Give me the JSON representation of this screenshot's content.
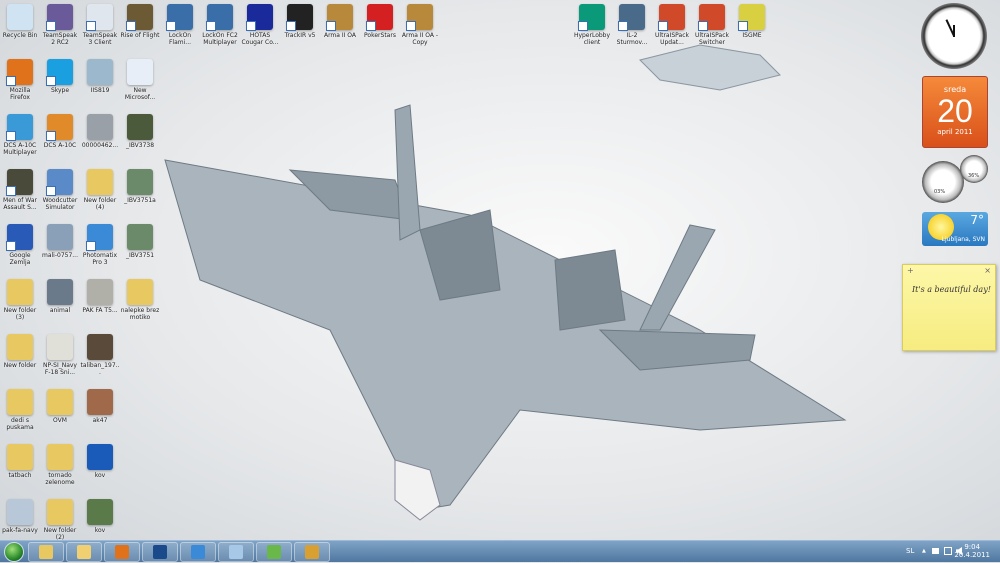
{
  "desktop_icons": [
    {
      "label": "Recycle Bin",
      "color": "#cfe3f2",
      "col": 0,
      "row": 0,
      "shortcut": false
    },
    {
      "label": "TeamSpeak 2 RC2",
      "color": "#6a5a9a",
      "col": 1,
      "row": 0
    },
    {
      "label": "TeamSpeak 3 Client",
      "color": "#dfe6ee",
      "col": 2,
      "row": 0
    },
    {
      "label": "Rise of Flight",
      "color": "#6b5a33",
      "col": 3,
      "row": 0
    },
    {
      "label": "LockOn Flami...",
      "color": "#3a6ea8",
      "col": 4,
      "row": 0
    },
    {
      "label": "LockOn FC2 Multiplayer",
      "color": "#3a6ea8",
      "col": 5,
      "row": 0
    },
    {
      "label": "HOTAS Cougar Co...",
      "color": "#1a2a9a",
      "col": 6,
      "row": 0
    },
    {
      "label": "TrackIR v5",
      "color": "#222222",
      "col": 7,
      "row": 0
    },
    {
      "label": "Arma II OA",
      "color": "#b8893a",
      "col": 8,
      "row": 0
    },
    {
      "label": "PokerStars",
      "color": "#d42020",
      "col": 9,
      "row": 0
    },
    {
      "label": "Arma II OA - Copy",
      "color": "#b8893a",
      "col": 10,
      "row": 0
    },
    {
      "label": "HyperLobby client",
      "color": "#0a9a7a",
      "col": 14.3,
      "row": 0
    },
    {
      "label": "IL-2 Sturmov...",
      "color": "#4a6a8a",
      "col": 15.3,
      "row": 0
    },
    {
      "label": "UltraISPack Updat...",
      "color": "#d04a2a",
      "col": 16.3,
      "row": 0
    },
    {
      "label": "UltraISPack Switcher",
      "color": "#d04a2a",
      "col": 17.3,
      "row": 0
    },
    {
      "label": "ISGME",
      "color": "#d8d040",
      "col": 18.3,
      "row": 0
    },
    {
      "label": "Mozilla Firefox",
      "color": "#e0721c",
      "col": 0,
      "row": 1
    },
    {
      "label": "Skype",
      "color": "#1aa0e0",
      "col": 1,
      "row": 1
    },
    {
      "label": "IIS819",
      "color": "#9bb8cc",
      "col": 2,
      "row": 1,
      "shortcut": false
    },
    {
      "label": "New Microsof...",
      "color": "#e8eef8",
      "col": 3,
      "row": 1,
      "shortcut": false
    },
    {
      "label": "DCS A-10C Multiplayer",
      "color": "#3a9ad8",
      "col": 0,
      "row": 2
    },
    {
      "label": "DCS A-10C",
      "color": "#e08a2a",
      "col": 1,
      "row": 2
    },
    {
      "label": "00000462...",
      "color": "#9aa0a8",
      "col": 2,
      "row": 2,
      "shortcut": false
    },
    {
      "label": "_IBV3738",
      "color": "#4a5a3a",
      "col": 3,
      "row": 2,
      "shortcut": false
    },
    {
      "label": "Men of War Assault S...",
      "color": "#4a4a3a",
      "col": 0,
      "row": 3
    },
    {
      "label": "Woodcutter Simulator",
      "color": "#5a8ac8",
      "col": 1,
      "row": 3
    },
    {
      "label": "New folder (4)",
      "color": "#e8c860",
      "col": 2,
      "row": 3,
      "shortcut": false
    },
    {
      "label": "_IBV3751a",
      "color": "#6a8a6a",
      "col": 3,
      "row": 3,
      "shortcut": false
    },
    {
      "label": "Google Zemlja",
      "color": "#2a5ab8",
      "col": 0,
      "row": 4
    },
    {
      "label": "mali-0757...",
      "color": "#8aa0b8",
      "col": 1,
      "row": 4,
      "shortcut": false
    },
    {
      "label": "Photomatix Pro 3",
      "color": "#3a8ad8",
      "col": 2,
      "row": 4
    },
    {
      "label": "_IBV3751",
      "color": "#6a8a6a",
      "col": 3,
      "row": 4,
      "shortcut": false
    },
    {
      "label": "New folder (3)",
      "color": "#e8c860",
      "col": 0,
      "row": 5,
      "shortcut": false
    },
    {
      "label": "animal",
      "color": "#6a7a8a",
      "col": 1,
      "row": 5,
      "shortcut": false
    },
    {
      "label": "PAK FA T5...",
      "color": "#b0b0a8",
      "col": 2,
      "row": 5,
      "shortcut": false
    },
    {
      "label": "nalepke brez motiko",
      "color": "#e8c860",
      "col": 3,
      "row": 5,
      "shortcut": false
    },
    {
      "label": "New folder",
      "color": "#e8c860",
      "col": 0,
      "row": 6,
      "shortcut": false
    },
    {
      "label": "NP-SI_Navy F-18 Sni...",
      "color": "#e0e0d8",
      "col": 1,
      "row": 6,
      "shortcut": false
    },
    {
      "label": "taliban_197...",
      "color": "#5a4a3a",
      "col": 2,
      "row": 6,
      "shortcut": false
    },
    {
      "label": "dedi s puskama",
      "color": "#e8c860",
      "col": 0,
      "row": 7,
      "shortcut": false
    },
    {
      "label": "OVM",
      "color": "#e8c860",
      "col": 1,
      "row": 7,
      "shortcut": false
    },
    {
      "label": "ak47",
      "color": "#a06a4a",
      "col": 2,
      "row": 7,
      "shortcut": false
    },
    {
      "label": "tatbach",
      "color": "#e8c860",
      "col": 0,
      "row": 8,
      "shortcut": false
    },
    {
      "label": "tornado zelenome",
      "color": "#e8c860",
      "col": 1,
      "row": 8,
      "shortcut": false
    },
    {
      "label": "kov",
      "color": "#1a5ab8",
      "col": 2,
      "row": 8,
      "shortcut": false
    },
    {
      "label": "pak-fa-navy",
      "color": "#b8c8d8",
      "col": 0,
      "row": 9,
      "shortcut": false
    },
    {
      "label": "New folder (2)",
      "color": "#e8c860",
      "col": 1,
      "row": 9,
      "shortcut": false
    },
    {
      "label": "kov",
      "color": "#5a7a4a",
      "col": 2,
      "row": 9,
      "shortcut": false
    }
  ],
  "gadgets": {
    "calendar": {
      "weekday": "sreda",
      "day": "20",
      "month_year": "april 2011",
      "color": "#e8641a"
    },
    "cpu_meter": {
      "cpu": "03%",
      "memory": "36%"
    },
    "weather": {
      "temperature": "7°",
      "location": "Ljubljana, SVN"
    },
    "sticky_note": {
      "text": "It's a beautiful day!",
      "add": "+",
      "close": "×"
    }
  },
  "taskbar": {
    "pinned": [
      {
        "name": "explorer",
        "color": "#e8c860"
      },
      {
        "name": "libraries",
        "color": "#f0d070"
      },
      {
        "name": "firefox",
        "color": "#e0721c"
      },
      {
        "name": "photoshop",
        "color": "#1a4a8a"
      },
      {
        "name": "internet-explorer",
        "color": "#3a8ad8"
      },
      {
        "name": "notepad",
        "color": "#a8c8e8"
      },
      {
        "name": "utorrent",
        "color": "#6ab84a"
      },
      {
        "name": "trackir",
        "color": "#d8a030"
      }
    ],
    "language": "SL",
    "tray_arrow": "▲",
    "time": "9:04",
    "date": "20.4.2011"
  }
}
